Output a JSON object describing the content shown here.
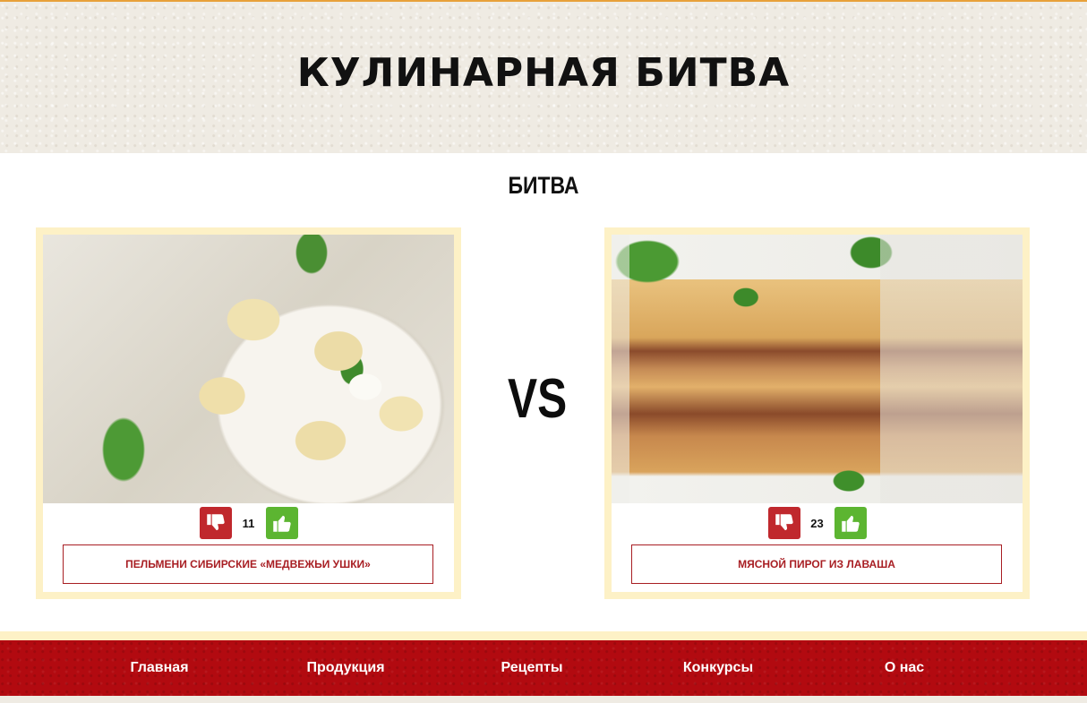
{
  "header": {
    "title": "КУЛИНАРНАЯ БИТВА"
  },
  "battle": {
    "title": "БИТВА",
    "vs_label": "VS",
    "left": {
      "image_alt": "pelmeni-photo",
      "votes": "11",
      "dish_name": "ПЕЛЬМЕНИ СИБИРСКИЕ «МЕДВЕЖЬИ УШКИ»"
    },
    "right": {
      "image_alt": "pie-photo",
      "votes": "23",
      "dish_name": "МЯСНОЙ ПИРОГ ИЗ ЛАВАША"
    }
  },
  "nav": {
    "items": [
      {
        "label": "Главная"
      },
      {
        "label": "Продукция"
      },
      {
        "label": "Рецепты"
      },
      {
        "label": "Конкурсы"
      },
      {
        "label": "О нас"
      }
    ]
  },
  "colors": {
    "brand_red": "#b20a10",
    "dislike_red": "#c0282d",
    "like_green": "#5cb531",
    "card_border": "#fdf1c6"
  },
  "icons": {
    "dislike": "thumbs-down-icon",
    "like": "thumbs-up-icon"
  }
}
